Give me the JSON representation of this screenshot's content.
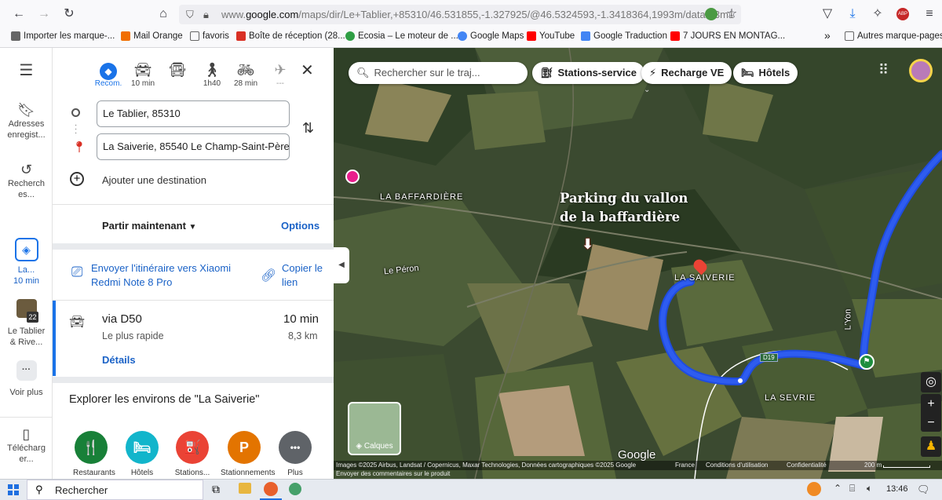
{
  "browser": {
    "url_prefix": "www.",
    "url_domain": "google.com",
    "url_rest": "/maps/dir/Le+Tablier,+85310/46.531855,-1.327925/@46.5324593,-1.3418364,1993m/data=!3m1",
    "bookmarks": [
      {
        "label": "Importer les marque-...",
        "icon": "import-icon",
        "color": "#555"
      },
      {
        "label": "Mail Orange",
        "icon": "mail-icon",
        "color": "#f16e00"
      },
      {
        "label": "favoris",
        "icon": "folder-icon",
        "color": "#777"
      },
      {
        "label": "Boîte de réception (28...",
        "icon": "gmail-icon",
        "color": "#d93025"
      },
      {
        "label": "Ecosia – Le moteur de ...",
        "icon": "ecosia-icon",
        "color": "#2f9e44"
      },
      {
        "label": "Google Maps",
        "icon": "google-icon",
        "color": "#4285f4"
      },
      {
        "label": "YouTube",
        "icon": "youtube-icon",
        "color": "#ff0000"
      },
      {
        "label": "Google Traduction",
        "icon": "translate-icon",
        "color": "#4285f4"
      },
      {
        "label": "7 JOURS EN MONTAG...",
        "icon": "youtube-icon",
        "color": "#ff0000"
      }
    ],
    "bookmarks_overflow": "»",
    "other_bookmarks": "Autres marque-pages"
  },
  "rail": {
    "saved_label": "Adresses enregist...",
    "recent_label": "Recherch es...",
    "directions_label": "La...",
    "directions_time": "10 min",
    "tablier_badge": "22",
    "tablier_label": "Le Tablier & Rive...",
    "more_label": "Voir plus",
    "download_label": "Télécharg er..."
  },
  "travel_modes": [
    {
      "icon": "best-route-icon",
      "label": "Recom."
    },
    {
      "icon": "car-icon",
      "label": "10 min"
    },
    {
      "icon": "transit-icon",
      "label": ""
    },
    {
      "icon": "walk-icon",
      "label": "1h40"
    },
    {
      "icon": "bike-icon",
      "label": "28 min"
    },
    {
      "icon": "plane-icon",
      "label": "---"
    }
  ],
  "route": {
    "origin": "Le Tablier, 85310",
    "destination": "La Saiverie, 85540 Le Champ-Saint-Père",
    "add_destination": "Ajouter une destination",
    "depart": "Partir maintenant",
    "options": "Options",
    "send_to_phone": "Envoyer l'itinéraire vers Xiaomi Redmi Note 8 Pro",
    "copy_link": "Copier le lien",
    "via": "via D50",
    "duration": "10 min",
    "subtitle": "Le plus rapide",
    "distance": "8,3 km",
    "details": "Détails"
  },
  "explore": {
    "title": "Explorer les environs de \"La Saiverie\"",
    "items": [
      {
        "label": "Restaurants",
        "icon": "fork-knife-icon",
        "color": "#188038",
        "glyph": "🍴"
      },
      {
        "label": "Hôtels",
        "icon": "bed-icon",
        "color": "#12b5cb",
        "glyph": "🛏"
      },
      {
        "label": "Stations...",
        "icon": "fuel-icon",
        "color": "#ea4335",
        "glyph": "⛽"
      },
      {
        "label": "Stationnements",
        "icon": "parking-icon",
        "color": "#e37400",
        "glyph": "P"
      },
      {
        "label": "Plus",
        "icon": "more-icon",
        "color": "#5f6368",
        "glyph": "•••"
      }
    ]
  },
  "map": {
    "search_placeholder": "Rechercher sur le traj...",
    "chips": [
      "Stations-service",
      "Recharge VE",
      "Hôtels"
    ],
    "annotation_line1": "Parking du vallon",
    "annotation_line2": "de la baffardière",
    "places": [
      "LA BAFFARDIÈRE",
      "Le Péron",
      "LA SAIVERIE",
      "LA SEVRIE",
      "L'Yon"
    ],
    "road_d19": "D19",
    "layers_label": "Calques",
    "google_logo": "Google",
    "attribution": "Images ©2025 Airbus, Landsat / Copernicus, Maxar Technologies, Données cartographiques ©2025 Google",
    "country": "France",
    "terms": "Conditions d'utilisation",
    "privacy": "Confidentialité",
    "scale": "200 m",
    "feedback": "Envoyer des commentaires sur le produit"
  },
  "taskbar": {
    "search": "Rechercher",
    "time": "13:46"
  }
}
